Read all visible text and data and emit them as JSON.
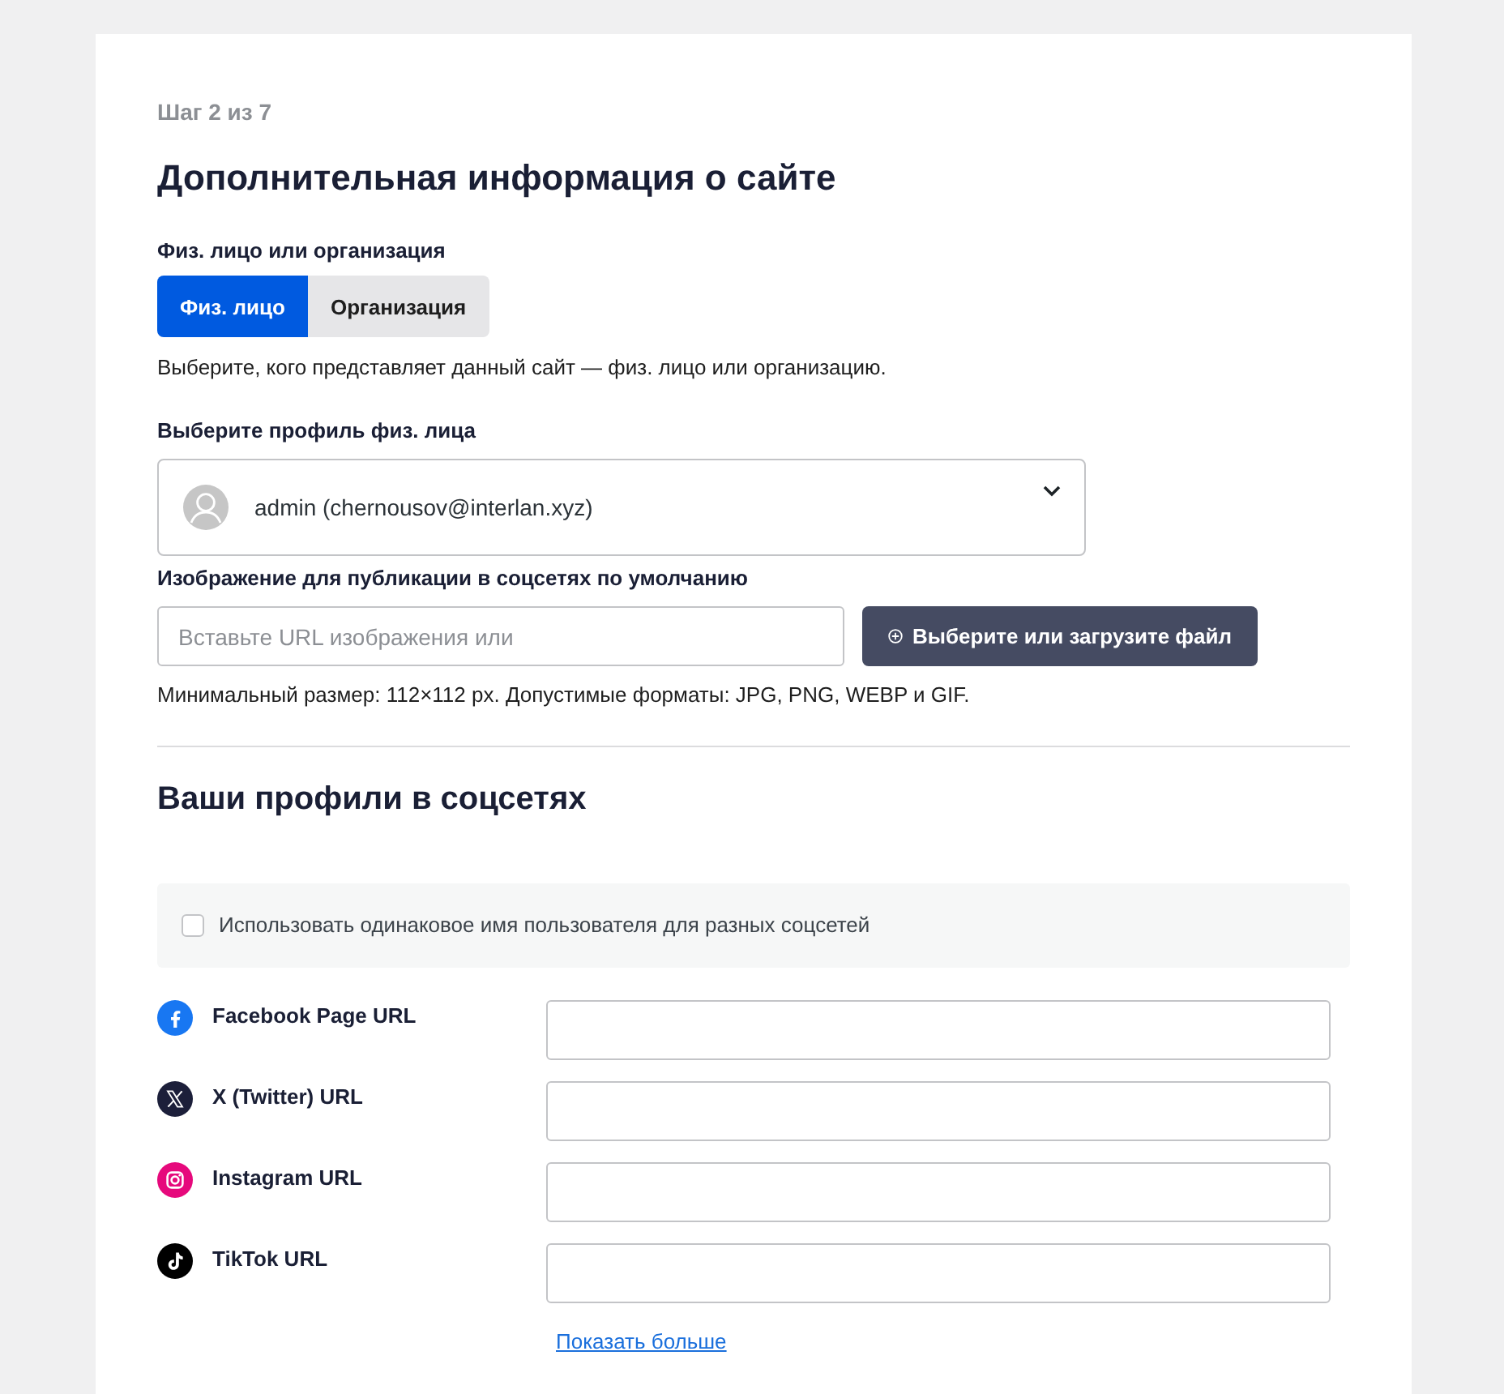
{
  "step": "Шаг 2 из 7",
  "title": "Дополнительная информация о сайте",
  "entity": {
    "label": "Физ. лицо или организация",
    "options": [
      {
        "label": "Физ. лицо",
        "selected": true
      },
      {
        "label": "Организация",
        "selected": false
      }
    ],
    "help": "Выберите, кого представляет данный сайт — физ. лицо или организацию."
  },
  "profile": {
    "label": "Выберите профиль физ. лица",
    "value": "admin (chernousov@interlan.xyz)"
  },
  "image": {
    "label": "Изображение для публикации в соцсетях по умолчанию",
    "placeholder": "Вставьте URL изображения или",
    "button": "Выберите или загрузите файл",
    "help": "Минимальный размер: 112×112 px. Допустимые форматы: JPG, PNG, WEBP и GIF."
  },
  "social": {
    "title": "Ваши профили в соцсетях",
    "same_username": {
      "label": "Использовать одинаковое имя пользователя для разных соцсетей",
      "checked": false
    },
    "profiles": [
      {
        "kind": "facebook",
        "label": "Facebook Page URL"
      },
      {
        "kind": "x",
        "label": "X (Twitter) URL"
      },
      {
        "kind": "instagram",
        "label": "Instagram URL"
      },
      {
        "kind": "tiktok",
        "label": "TikTok URL"
      }
    ],
    "more_link": "Показать больше"
  }
}
